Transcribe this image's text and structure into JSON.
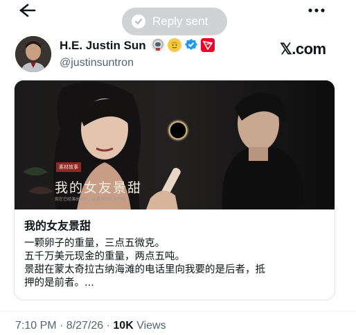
{
  "toast": {
    "text": "Reply sent"
  },
  "author": {
    "name": "H.E. Justin Sun",
    "handle": "@justinsuntron",
    "badges": [
      "astronaut-emoji",
      "face-emoji",
      "verified-badge",
      "tron-logo"
    ]
  },
  "brand": "𝕏.com",
  "card": {
    "image": {
      "tag": "素材故事",
      "title": "我的女友景甜",
      "subtitle": "现在已经演出改名，光是甲的完全不同"
    },
    "title": "我的女友景甜",
    "body_lines": [
      "一颗卵子的重量，三点五微克。",
      "五千万美元现金的重量，两点五吨。",
      "景甜在蒙太奇拉古纳海滩的电话里向我要的是后者，抵",
      "押的是前者。..."
    ]
  },
  "meta": {
    "time_date": "7:10 PM · 8/27/26 · ",
    "views_count": "10K",
    "views_label": " Views"
  },
  "colors": {
    "accent": "#1d9bf0",
    "toast_bg": "#d0d2d4",
    "secondary_text": "#536471"
  }
}
